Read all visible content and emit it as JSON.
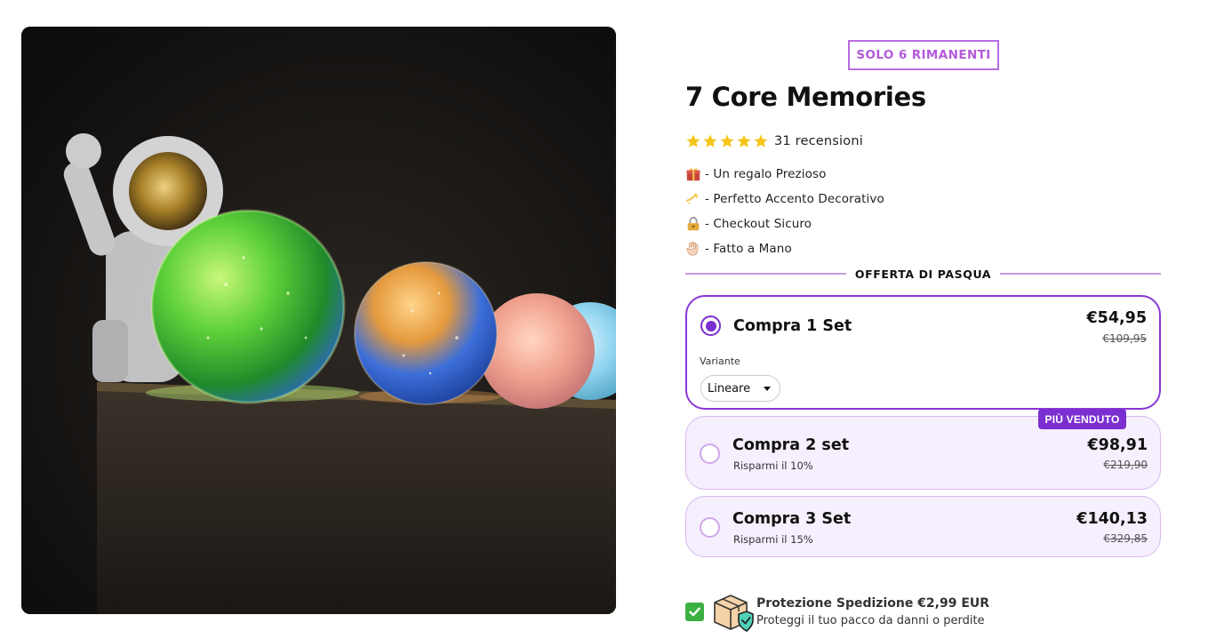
{
  "product": {
    "stock_badge": "SOLO 6 RIMANENTI",
    "title": "7 Core Memories",
    "rating": {
      "stars": 5,
      "reviews_label": "31 recensioni"
    },
    "features": [
      {
        "icon": "gift-icon",
        "text": "- Un regalo Prezioso"
      },
      {
        "icon": "sparkles-icon",
        "text": "- Perfetto Accento Decorativo"
      },
      {
        "icon": "lock-icon",
        "text": "- Checkout Sicuro"
      },
      {
        "icon": "hand-icon",
        "text": "- Fatto a Mano"
      }
    ]
  },
  "offer": {
    "heading": "OFFERTA DI PASQUA",
    "options": [
      {
        "title": "Compra 1 Set",
        "subtitle": "",
        "price": "€54,95",
        "old_price": "€109,95",
        "selected": true,
        "variant_label": "Variante",
        "variant_value": "Lineare"
      },
      {
        "title": "Compra 2 set",
        "subtitle": "Risparmi il 10%",
        "price": "€98,91",
        "old_price": "€219,90",
        "selected": false,
        "badge": "PIÙ VENDUTO"
      },
      {
        "title": "Compra 3 Set",
        "subtitle": "Risparmi il 15%",
        "price": "€140,13",
        "old_price": "€329,85",
        "selected": false
      }
    ]
  },
  "shipping": {
    "checked": true,
    "title": "Protezione Spedizione €2,99 EUR",
    "subtitle": "Proteggi il tuo pacco da danni o perdite"
  },
  "colors": {
    "accent": "#7b2fd0",
    "badge_text": "#b35ad9",
    "option_bg": "#f6effd",
    "check_green": "#3cb043",
    "star": "#f5c518"
  }
}
